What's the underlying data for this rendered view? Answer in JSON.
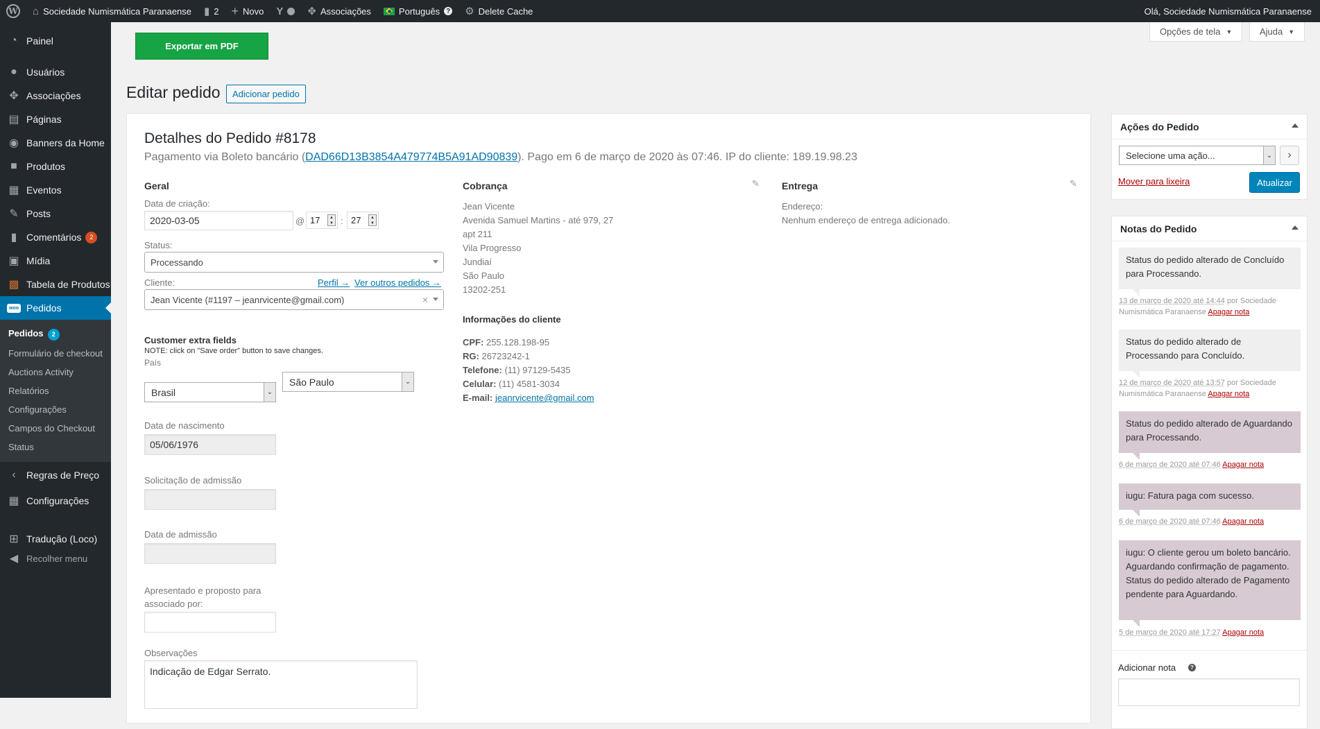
{
  "adminbar": {
    "wp_logo": "W",
    "site_name": "Sociedade Numismática Paranaense",
    "comments_count": "2",
    "new_label": "Novo",
    "associations_label": "Associações",
    "language_label": "Português",
    "delete_cache_label": "Delete Cache",
    "greeting": "Olá, Sociedade Numismática Paranaense"
  },
  "sidebar": {
    "items": [
      {
        "label": "Painel",
        "icon": "dashboard-icon"
      },
      {
        "label": "Usuários",
        "icon": "users-icon"
      },
      {
        "label": "Associações",
        "icon": "groups-icon"
      },
      {
        "label": "Páginas",
        "icon": "pages-icon"
      },
      {
        "label": "Banners da Home",
        "icon": "banner-icon"
      },
      {
        "label": "Produtos",
        "icon": "products-icon"
      },
      {
        "label": "Eventos",
        "icon": "calendar-icon"
      },
      {
        "label": "Posts",
        "icon": "pin-icon"
      },
      {
        "label": "Comentários",
        "icon": "comments-icon",
        "badge": "2"
      },
      {
        "label": "Mídia",
        "icon": "media-icon"
      },
      {
        "label": "Tabela de Produtos",
        "icon": "table-icon"
      },
      {
        "label": "Pedidos",
        "icon": "woo-icon",
        "icon_text": "woo"
      }
    ],
    "submenu": [
      {
        "label": "Pedidos",
        "badge": "2"
      },
      {
        "label": "Formulário de checkout"
      },
      {
        "label": "Auctions Activity"
      },
      {
        "label": "Relatórios"
      },
      {
        "label": "Configurações"
      },
      {
        "label": "Campos do Checkout"
      },
      {
        "label": "Status"
      }
    ],
    "after": [
      {
        "label": "Regras de Preço",
        "icon": "chevron-left-icon"
      },
      {
        "label": "Configurações",
        "icon": "settings-icon"
      },
      {
        "label": "Tradução (Loco)",
        "icon": "translate-icon"
      },
      {
        "label": "Recolher menu",
        "icon": "collapse-icon"
      }
    ]
  },
  "screen_options": {
    "options_label": "Opções de tela",
    "help_label": "Ajuda"
  },
  "export_pdf_label": "Exportar em PDF",
  "page": {
    "title": "Editar pedido",
    "add_label": "Adicionar pedido"
  },
  "order": {
    "heading": "Detalhes do Pedido #8178",
    "payment_prefix": "Pagamento via Boleto bancário (",
    "transaction_id": "DAD66D13B3854A479774B5A91AD90839",
    "payment_suffix": "). Pago em 6 de março de 2020 às 07:46. IP do cliente: 189.19.98.23",
    "general": {
      "heading": "Geral",
      "date_label": "Data de criação:",
      "date_value": "2020-03-05",
      "at": "@",
      "hour": "17",
      "colon": ":",
      "minute": "27",
      "status_label": "Status:",
      "status_value": "Processando",
      "customer_label": "Cliente:",
      "profile_link": "Perfil →",
      "other_orders_link": "Ver outros pedidos →",
      "customer_value": "Jean Vicente (#1197 – jeanrvicente@gmail.com)",
      "clear": "×"
    },
    "extra": {
      "heading": "Customer extra fields",
      "note": "NOTE: click on \"Save order\" button to save changes.",
      "country_label": "País",
      "country_value": "Brasil",
      "state_value": "São Paulo",
      "birth_label": "Data de nascimento",
      "birth_value": "05/06/1976",
      "admission_request_label": "Solicitação de admissão",
      "admission_date_label": "Data de admissão",
      "presented_label": "Apresentado e proposto para associado por:",
      "observations_label": "Observações",
      "observations_value": "Indicação de Edgar Serrato."
    },
    "billing": {
      "heading": "Cobrança",
      "lines": [
        "Jean Vicente",
        "Avenida Samuel Martins - até 979, 27",
        "apt 211",
        "Vila Progresso",
        "Jundiaí",
        "São Paulo",
        "13202-251"
      ],
      "info_heading": "Informações do cliente",
      "cpf_label": "CPF:",
      "cpf": "255.128.198-95",
      "rg_label": "RG:",
      "rg": "26723242-1",
      "phone_label": "Telefone:",
      "phone": "(11) 97129-5435",
      "mobile_label": "Celular:",
      "mobile": "(11) 4581-3034",
      "email_label": "E-mail:",
      "email": "jeanrvicente@gmail.com"
    },
    "shipping": {
      "heading": "Entrega",
      "address_label": "Endereço:",
      "address_value": "Nenhum endereço de entrega adicionado."
    }
  },
  "actions_box": {
    "title": "Ações do Pedido",
    "select_placeholder": "Selecione uma ação...",
    "go": "›",
    "trash": "Mover para lixeira",
    "update": "Atualizar"
  },
  "notes_box": {
    "title": "Notas do Pedido",
    "notes": [
      {
        "text": "Status do pedido alterado de Concluído para Processando.",
        "date": "13 de março de 2020 até 14:44",
        "by": " por Sociedade Numismática Paranaense ",
        "delete": "Apagar nota"
      },
      {
        "text": "Status do pedido alterado de Processando para Concluído.",
        "date": "12 de março de 2020 até 13:57",
        "by": " por Sociedade Numismática Paranaense ",
        "delete": "Apagar nota"
      },
      {
        "text": "Status do pedido alterado de Aguardando para Processando.",
        "date": "6 de março de 2020 até 07:46",
        "by": " ",
        "delete": "Apagar nota"
      },
      {
        "text": "iugu: Fatura paga com sucesso.",
        "date": "6 de março de 2020 até 07:46",
        "by": " ",
        "delete": "Apagar nota"
      },
      {
        "text": "iugu: O cliente gerou um boleto bancário. Aguardando confirmação de pagamento. Status do pedido alterado de Pagamento pendente para Aguardando.",
        "date": "5 de março de 2020 até 17:27",
        "by": " ",
        "delete": "Apagar nota"
      }
    ],
    "add_note_label": "Adicionar nota",
    "help": "?"
  }
}
